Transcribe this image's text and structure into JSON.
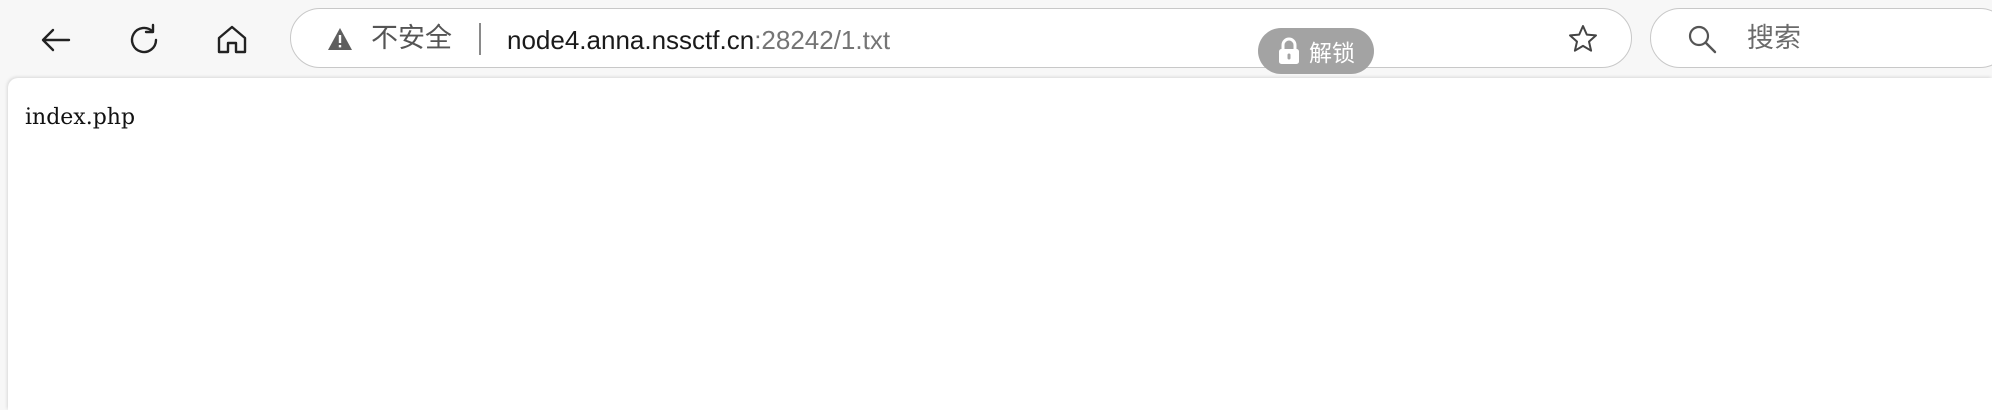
{
  "toolbar": {
    "back_icon": "arrow-left-icon",
    "reload_icon": "refresh-icon",
    "home_icon": "home-icon"
  },
  "address_bar": {
    "security_icon": "warning-triangle-icon",
    "security_label": "不安全",
    "url_host": "node4.anna.nssctf.cn",
    "url_rest": ":28242/1.txt",
    "favorite_icon": "star-icon"
  },
  "unlock_button": {
    "icon": "lock-icon",
    "label": "解锁"
  },
  "search": {
    "icon": "search-icon",
    "placeholder": "搜索"
  },
  "page": {
    "content": "index.php"
  },
  "colors": {
    "toolbar_bg": "#f7f7f7",
    "field_bg": "#ffffff",
    "field_border": "#c8c8c8",
    "unlock_pill_bg": "#a3a3a3",
    "url_host_text": "#1a1a1a",
    "url_rest_text": "#757575"
  }
}
